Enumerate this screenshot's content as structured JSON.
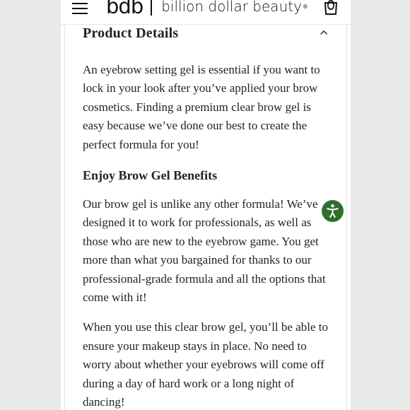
{
  "header": {
    "menu_icon": "menu-icon",
    "logo_mark": "bdb",
    "brand_name": "billion dollar beauty",
    "registered_mark": "®",
    "cart_icon": "shopping-bag-icon"
  },
  "product_details": {
    "title": "Product Details",
    "toggle_icon": "chevron-up-icon",
    "paragraphs": [
      "An eyebrow setting gel is essential if you want to lock in your look after you’ve applied your brow cosmetics. Finding a premium clear brow gel is easy because we’ve done our best to create the perfect formula for you!",
      "Our brow gel is unlike any other formula! We’ve designed it to work for professionals, as well as those who are new to the eyebrow game. You get more than what you bargained for thanks to our professional-grade formula and all the options that come with it!",
      "When you use this clear brow gel, you’ll be able to ensure your makeup stays in place. No need to worry about whether your eyebrows will come off during a day of hard work or a long night of dancing!"
    ],
    "subheading": "Enjoy Brow Gel Benefits"
  },
  "accessibility": {
    "icon": "accessibility-icon",
    "color": "#2f6f2d"
  }
}
